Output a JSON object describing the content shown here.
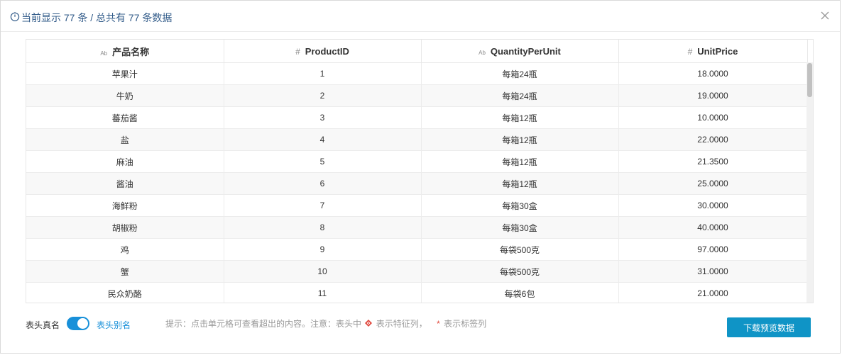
{
  "header": {
    "title": "当前显示 77 条 / 总共有 77 条数据"
  },
  "table": {
    "columns": [
      {
        "type_icon": "Ab",
        "label": "产品名称"
      },
      {
        "type_icon": "#",
        "label": "ProductID"
      },
      {
        "type_icon": "Ab",
        "label": "QuantityPerUnit"
      },
      {
        "type_icon": "#",
        "label": "UnitPrice"
      }
    ],
    "rows": [
      [
        "苹果汁",
        "1",
        "每箱24瓶",
        "18.0000"
      ],
      [
        "牛奶",
        "2",
        "每箱24瓶",
        "19.0000"
      ],
      [
        "蕃茄酱",
        "3",
        "每箱12瓶",
        "10.0000"
      ],
      [
        "盐",
        "4",
        "每箱12瓶",
        "22.0000"
      ],
      [
        "麻油",
        "5",
        "每箱12瓶",
        "21.3500"
      ],
      [
        "酱油",
        "6",
        "每箱12瓶",
        "25.0000"
      ],
      [
        "海鲜粉",
        "7",
        "每箱30盒",
        "30.0000"
      ],
      [
        "胡椒粉",
        "8",
        "每箱30盒",
        "40.0000"
      ],
      [
        "鸡",
        "9",
        "每袋500克",
        "97.0000"
      ],
      [
        "蟹",
        "10",
        "每袋500克",
        "31.0000"
      ],
      [
        "民众奶酪",
        "11",
        "每袋6包",
        "21.0000"
      ]
    ]
  },
  "footer": {
    "toggle_left_label": "表头真名",
    "toggle_right_label": "表头别名",
    "toggle_on": true,
    "hint_prefix": "提示：点击单元格可查看超出的内容。注意：表头中",
    "hint_feature_suffix": "表示特征列，",
    "hint_star": "*",
    "hint_star_suffix": "表示标签列",
    "download_label": "下载预览数据"
  },
  "colors": {
    "accent": "#1890d9",
    "button": "#0f94c6",
    "title": "#335c8a",
    "feature_icon": "#e0453a"
  },
  "icons": {
    "header": "stopwatch-icon",
    "close": "close-icon",
    "text_type": "text-type-icon",
    "number_type": "number-type-icon",
    "feature": "feature-column-icon"
  }
}
